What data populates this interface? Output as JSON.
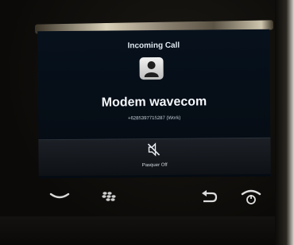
{
  "call": {
    "title": "Incoming Call",
    "caller_name": "Modem wavecom",
    "caller_number": "+6285397715287 (Work)",
    "mute_label": "Pasquer Off"
  },
  "icons": {
    "avatar": "contact-avatar-icon",
    "mute": "speaker-mute-icon",
    "call": "call-key-icon",
    "menu": "blackberry-menu-icon",
    "back": "back-key-icon",
    "end": "end-call-key-icon"
  },
  "colors": {
    "screen_bg": "#07111c",
    "text": "#f4f7fa",
    "device_body": "#0b0a08"
  }
}
